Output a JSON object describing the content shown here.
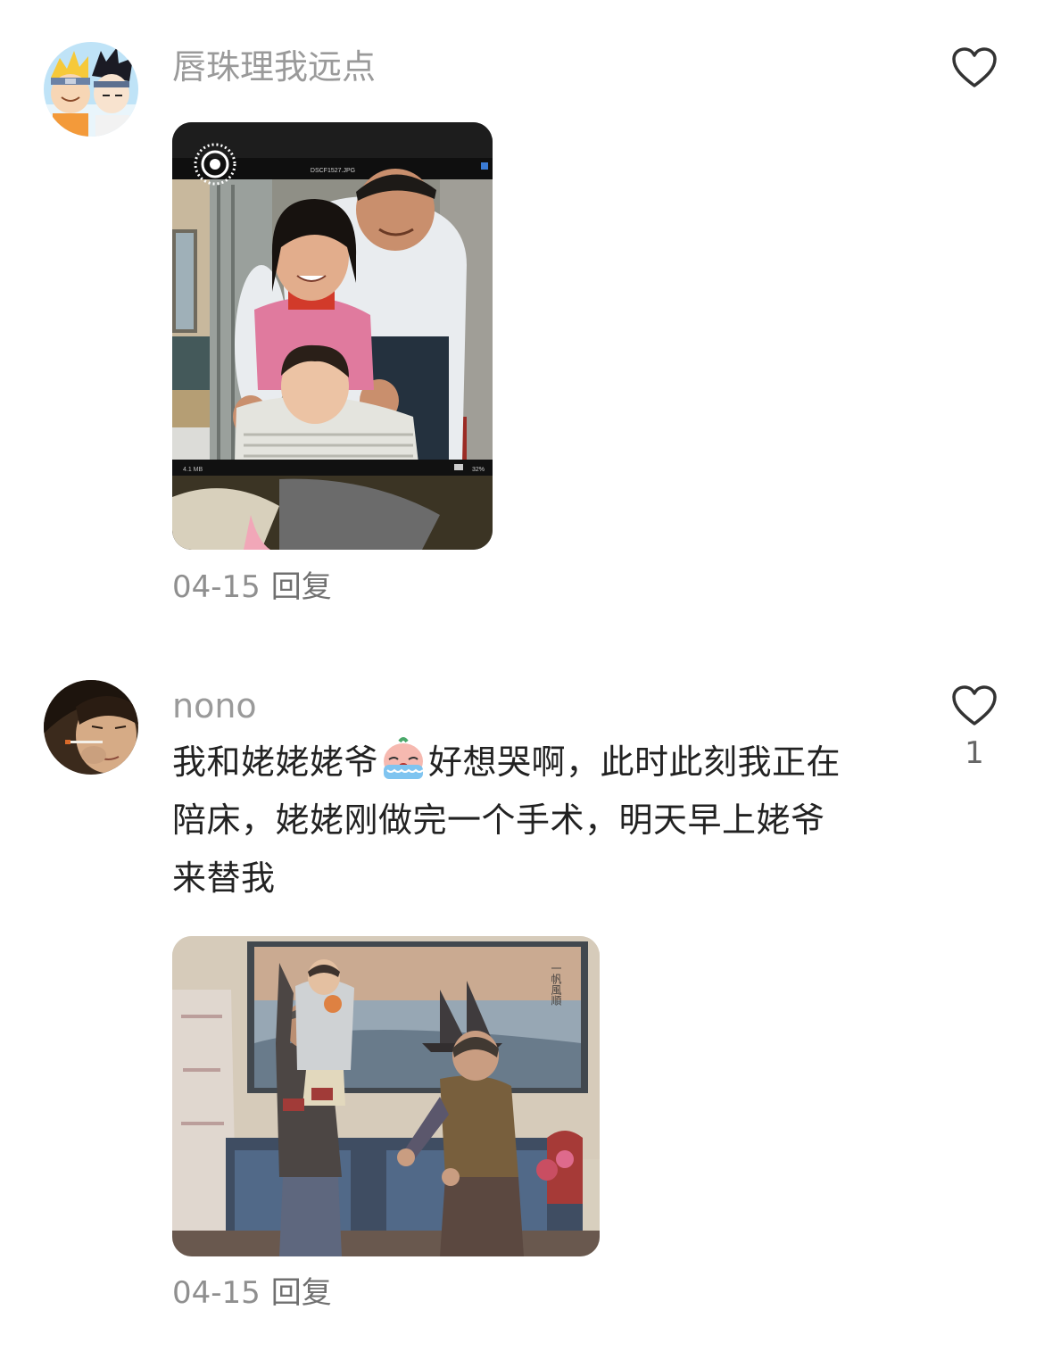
{
  "comments": [
    {
      "username": "唇珠理我远点",
      "text": "",
      "date": "04-15",
      "reply_label": "回复",
      "like_count": "",
      "photo_caption": "DSCF1527.JPG",
      "photo_size": "4.1 MB",
      "photo_zoom": "32%"
    },
    {
      "username": "nono",
      "text_line1_a": "我和姥姥姥爷",
      "text_line1_b": "好想哭啊，此时此刻我正在",
      "text_line2": "陪床，姥姥刚做完一个手术，明天早上姥爷",
      "text_line3": "来替我",
      "date": "04-15",
      "reply_label": "回复",
      "like_count": "1",
      "photo_sign": "一帆風順"
    }
  ],
  "icons": {
    "like": "heart-outline-icon",
    "emoji": "crying-face-emoji-icon"
  },
  "colors": {
    "username": "#9a9a9a",
    "body_text": "#222222",
    "meta": "#8f8f8f"
  }
}
